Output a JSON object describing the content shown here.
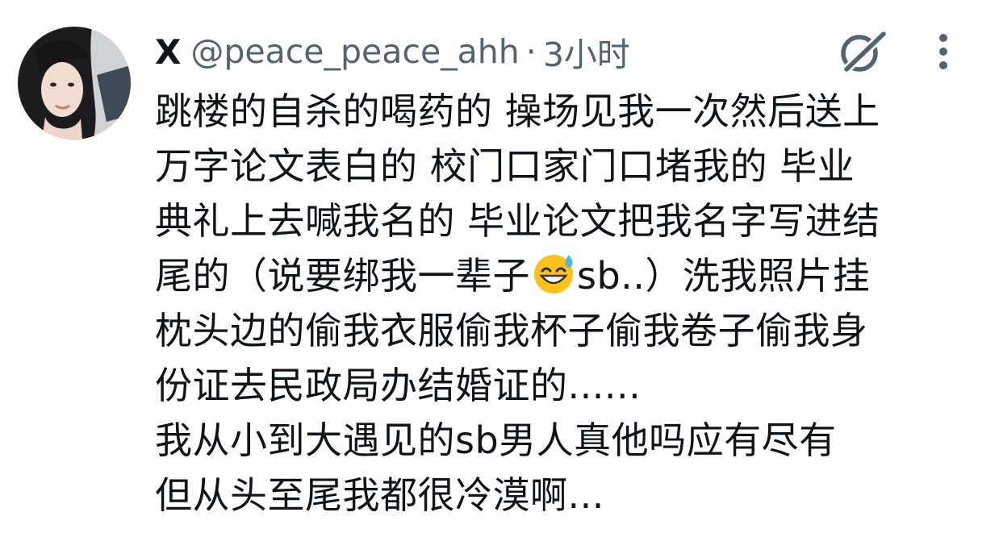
{
  "tweet": {
    "display_name": "X",
    "handle": "@peace_peace_ahh",
    "separator": "·",
    "time": "3小时",
    "lines": [
      "跳楼的自杀的喝药的 操场见我一次然后送上",
      "万字论文表白的 校门口家门口堵我的 毕业",
      "典礼上去喊我名的 毕业论文把我名字写进结"
    ],
    "line4_before_emoji": "尾的（说要绑我一辈子",
    "emoji_name": "grinning-face-with-sweat-emoji",
    "line4_after_emoji": "sb..）洗我照片挂",
    "lines_rest": [
      "枕头边的偷我衣服偷我杯子偷我卷子偷我身",
      "份证去民政局办结婚证的......",
      "我从小到大遇见的sb男人真他吗应有尽有",
      "但从头至尾我都很冷漠啊..."
    ]
  },
  "icons": {
    "grok": "grok-icon",
    "more": "more-vertical-icon"
  },
  "colors": {
    "text": "#0f1419",
    "secondary": "#536471"
  }
}
